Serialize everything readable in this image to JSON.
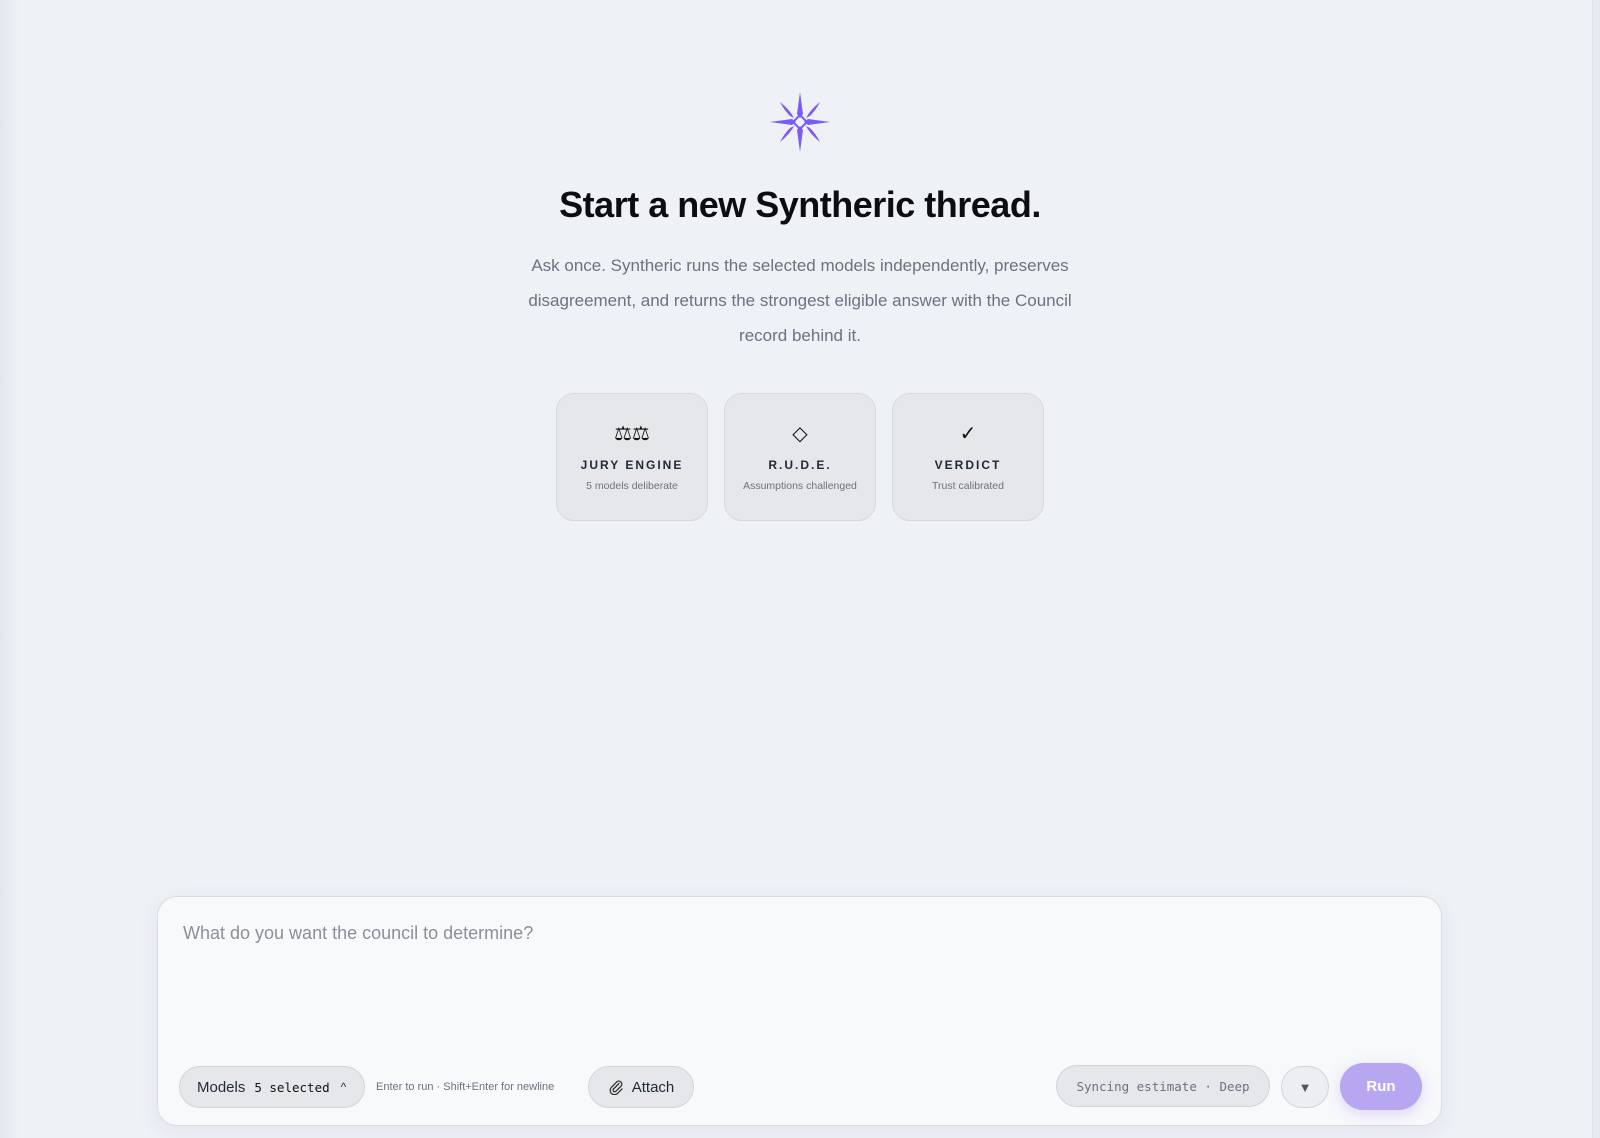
{
  "hero": {
    "logo_icon": "starburst-logo-icon",
    "title": "Start a new Syntheric thread.",
    "subtitle": "Ask once. Syntheric runs the selected models independently, preserves disagreement, and returns the strongest eligible answer with the Council record behind it."
  },
  "cards": [
    {
      "icon": "⚖⚖",
      "icon_name": "scales-icon",
      "title": "JURY ENGINE",
      "subtitle": "5 models deliberate"
    },
    {
      "icon": "◇",
      "icon_name": "diamond-icon",
      "title": "R.U.D.E.",
      "subtitle": "Assumptions challenged"
    },
    {
      "icon": "✓",
      "icon_name": "checkmark-icon",
      "title": "VERDICT",
      "subtitle": "Trust calibrated"
    }
  ],
  "composer": {
    "placeholder": "What do you want the council to determine?",
    "models_label": "Models",
    "models_count": "5 selected",
    "models_caret": "^",
    "hint": "Enter to run · Shift+Enter for newline",
    "attach_label": "Attach",
    "estimate": "Syncing estimate · Deep",
    "mode_caret": "▼",
    "run_label": "Run"
  },
  "colors": {
    "background": "#eef1f6",
    "accent": "#b7a6f0",
    "logo_purple": "#7c5cf5"
  }
}
